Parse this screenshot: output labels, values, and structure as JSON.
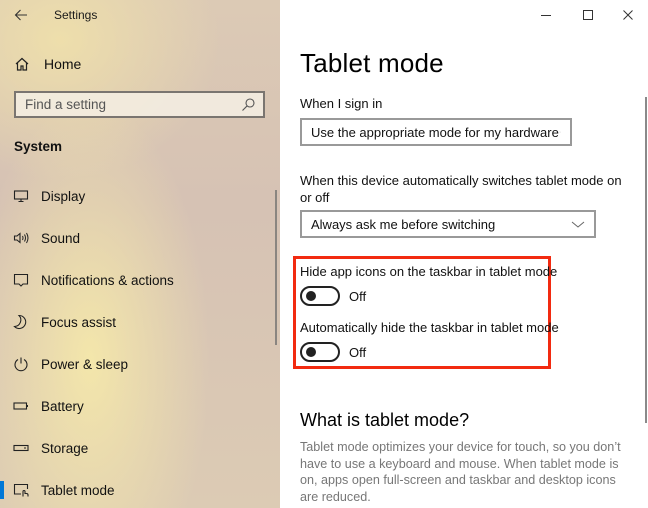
{
  "window": {
    "app_title": "Settings",
    "controls": [
      "minimize",
      "maximize",
      "close"
    ]
  },
  "sidebar": {
    "home_label": "Home",
    "search": {
      "placeholder": "Find a setting"
    },
    "section_title": "System",
    "items": [
      {
        "label": "Display",
        "icon": "display-icon"
      },
      {
        "label": "Sound",
        "icon": "sound-icon"
      },
      {
        "label": "Notifications & actions",
        "icon": "notifications-icon"
      },
      {
        "label": "Focus assist",
        "icon": "focus-assist-icon"
      },
      {
        "label": "Power & sleep",
        "icon": "power-icon"
      },
      {
        "label": "Battery",
        "icon": "battery-icon"
      },
      {
        "label": "Storage",
        "icon": "storage-icon"
      },
      {
        "label": "Tablet mode",
        "icon": "tablet-mode-icon",
        "active": true
      }
    ]
  },
  "main": {
    "title": "Tablet mode",
    "sign_in": {
      "label": "When I sign in",
      "selected": "Use the appropriate mode for my hardware"
    },
    "auto_switch": {
      "label": "When this device automatically switches tablet mode on or off",
      "selected": "Always ask me before switching"
    },
    "toggles": [
      {
        "label": "Hide app icons on the taskbar in tablet mode",
        "state": "Off",
        "on": false
      },
      {
        "label": "Automatically hide the taskbar in tablet mode",
        "state": "Off",
        "on": false
      }
    ],
    "info": {
      "heading": "What is tablet mode?",
      "text": "Tablet mode optimizes your device for touch, so you don’t have to use a keyboard and mouse. When tablet mode is on, apps open full-screen and taskbar and desktop icons are reduced."
    }
  },
  "colors": {
    "accent": "#0078d7",
    "highlight_border": "#f22a10"
  }
}
